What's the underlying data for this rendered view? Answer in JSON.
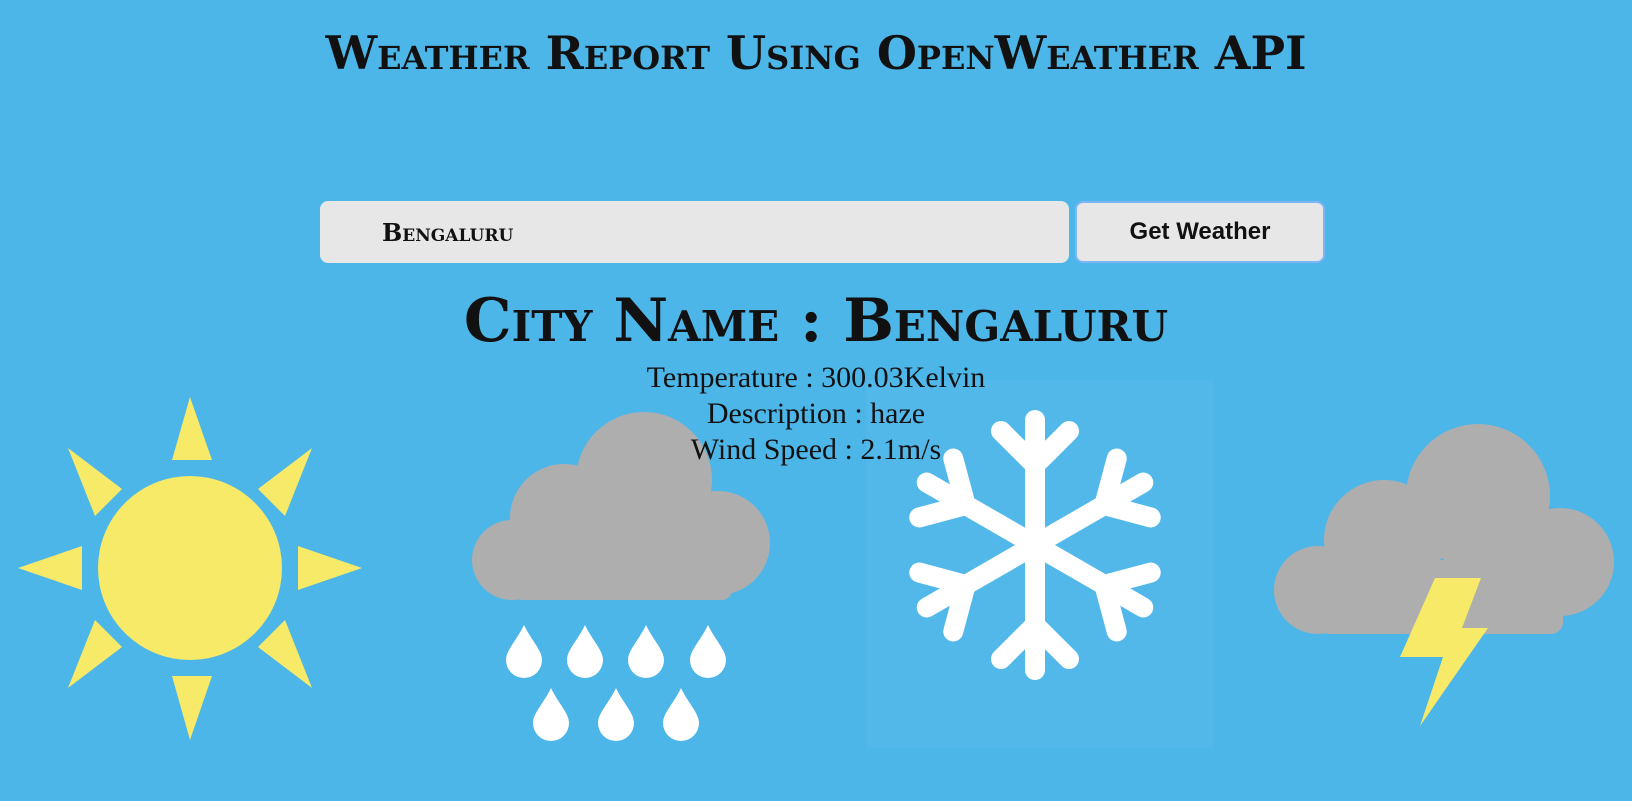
{
  "page": {
    "title": "Weather Report Using OpenWeather API"
  },
  "search": {
    "value": "Bengaluru",
    "button_label": "Get Weather"
  },
  "result": {
    "city_prefix": "City Name : ",
    "city": "Bengaluru",
    "temperature_text": "Temperature : 300.03Kelvin",
    "description_text": "Description : haze",
    "wind_text": "Wind Speed : 2.1m/s"
  },
  "background_icons": [
    "sun-icon",
    "rain-cloud-icon",
    "snowflake-icon",
    "thunderstorm-icon"
  ],
  "colors": {
    "background": "#4db6e8",
    "sun": "#f6ea68",
    "cloud": "#aeaeae",
    "snow": "#ffffff",
    "input_bg": "#e7e7e8",
    "button_border": "#7cb6f5"
  }
}
